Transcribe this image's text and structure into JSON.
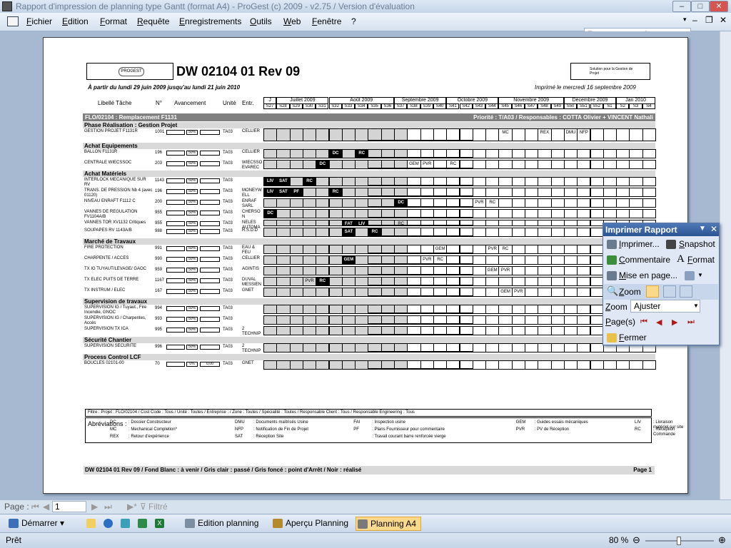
{
  "window": {
    "title": "Rapport d'impression de planning type Gantt (format A4) - ProGest (c) 2009 - v2.75 / Version d'évaluation"
  },
  "menu": {
    "items": [
      "Fichier",
      "Edition",
      "Format",
      "Requête",
      "Enregistrements",
      "Outils",
      "Web",
      "Fenêtre",
      "?"
    ],
    "ask_placeholder": "Tapez une question"
  },
  "report": {
    "title": "DW 02104 01 Rev 09",
    "period": "À partir du lundi 29 juin 2009 jusqu'au lundi 21 juin 2010",
    "printed": "Imprimé le mercredi 16 septembre 2009",
    "logo_left": "PROGEST",
    "logo_right": "Solution pour la Gestion de Projet",
    "columns": {
      "task": "Libellé Tâche",
      "num": "N°",
      "progress": "Avancement",
      "unit": "Unité",
      "entr": "Entr."
    },
    "months": [
      "J",
      "Juillet 2009",
      "Août 2009",
      "Septembre 2009",
      "Octobre 2009",
      "Novembre 2009",
      "Décembre 2009",
      "Jan 2010"
    ],
    "weeks": [
      "S27",
      "S28",
      "S29",
      "S30",
      "S31",
      "S32",
      "S33",
      "S34",
      "S35",
      "S36",
      "S37",
      "S38",
      "S39",
      "S40",
      "S41",
      "S42",
      "S43",
      "S44",
      "S45",
      "S46",
      "S47",
      "S48",
      "S49",
      "S50",
      "S51",
      "S52",
      "S1",
      "S2",
      "S3",
      "S4"
    ],
    "project_band": {
      "left": "FLO/02104 : Remplacement F1131",
      "right": "Priorité : T/A03 / Responsables : COTTA Olivier + VINCENT Nathali"
    },
    "phases": [
      {
        "name": "Phase Réalisation : Gestion Projet",
        "tasks": [
          {
            "label": "GESTION PROJET F1131R",
            "num": "1001",
            "pct": "50%",
            "unit": "TA03",
            "entr": "CELLIER",
            "marks": [
              "MC",
              "REX",
              "DMU",
              "NFP"
            ]
          }
        ]
      },
      {
        "name": "Achat Equipements",
        "tasks": [
          {
            "label": "BALLON F1131R",
            "num": "196",
            "pct": "50%",
            "unit": "TA03",
            "entr": "CELLIER",
            "marks": [
              "DC",
              "RC"
            ]
          },
          {
            "label": "CENTRALE WIECSSOC",
            "num": "203",
            "pct": "50%",
            "unit": "TA03",
            "entr": "WIECSSO EVAREC",
            "marks": [
              "DC",
              "GEM",
              "PVR",
              "RC"
            ]
          }
        ]
      },
      {
        "name": "Achat Matériels",
        "tasks": [
          {
            "label": "INTERLOCK MECANIQUE SUR RV",
            "num": "1143",
            "pct": "50%",
            "unit": "TA03",
            "entr": "",
            "marks": [
              "LIV",
              "SAT",
              "RC"
            ]
          },
          {
            "label": "TRANS. DE PRESSION Nb 4 (avec 01120)",
            "num": "196",
            "pct": "50%",
            "unit": "TA03",
            "entr": "MONEYW ELL",
            "marks": [
              "LIV",
              "SAT",
              "PF",
              "RC"
            ]
          },
          {
            "label": "NIVEAU ENRAFT F1112 C",
            "num": "200",
            "pct": "50%",
            "unit": "TA03",
            "entr": "ENRAF SARL",
            "marks": [
              "DC",
              "PVR",
              "RC"
            ]
          },
          {
            "label": "VANNES DE REGULATION FV1104A/B",
            "num": "955",
            "pct": "50%",
            "unit": "TA03",
            "entr": "CHERSO N",
            "marks": [
              "DC"
            ]
          },
          {
            "label": "VANNES TOR XV1132 Critiques",
            "num": "955",
            "pct": "50%",
            "unit": "TA03",
            "entr": "NELES AUTOMA",
            "marks": [
              "FAT",
              "LIV",
              "RC"
            ]
          },
          {
            "label": "SOUPAPES RV 1143A/B",
            "num": "988",
            "pct": "50%",
            "unit": "TA03",
            "entr": "R.S.D.D",
            "marks": [
              "SAT",
              "RC"
            ]
          }
        ]
      },
      {
        "name": "Marché de Travaux",
        "tasks": [
          {
            "label": "FIRE PROTECTION",
            "num": "991",
            "pct": "50%",
            "unit": "TA03",
            "entr": "EAU & FEU",
            "marks": [
              "GEM",
              "PVR",
              "RC"
            ]
          },
          {
            "label": "CHARPENTE / ACCES",
            "num": "990",
            "pct": "50%",
            "unit": "TA03",
            "entr": "CELLIER",
            "marks": [
              "GEM",
              "PVR",
              "RC"
            ]
          },
          {
            "label": "TX IG TUYAUT/LEVAGE/ GAOC",
            "num": "959",
            "pct": "50%",
            "unit": "TA03",
            "entr": "AGINTIS",
            "marks": [
              "GEM",
              "PVR"
            ]
          },
          {
            "label": "TX ELEC PUITS DE TERRE",
            "num": "1167",
            "pct": "50%",
            "unit": "TA03",
            "entr": "DUVAL MESSIEN",
            "marks": [
              "PVR",
              "RC"
            ]
          },
          {
            "label": "TX INSTRUM / ELEC",
            "num": "167",
            "pct": "50%",
            "unit": "TA03",
            "entr": "GNET",
            "marks": [
              "GEM",
              "PVR"
            ]
          }
        ]
      },
      {
        "name": "Supervision de travaux",
        "tasks": [
          {
            "label": "SUPERVISION IG / Tuyaut., Fire Incendie, GNOC",
            "num": "994",
            "pct": "50%",
            "unit": "TA03",
            "entr": "",
            "marks": []
          },
          {
            "label": "SUPERVISION IG / Charpentes, Accès",
            "num": "993",
            "pct": "50%",
            "unit": "TA03",
            "entr": "",
            "marks": []
          },
          {
            "label": "SUPERVISION TX ICA",
            "num": "995",
            "pct": "50%",
            "unit": "TA03",
            "entr": "2 TECHNIP",
            "marks": []
          }
        ]
      },
      {
        "name": "Sécurité Chantier",
        "tasks": [
          {
            "label": "SUPERVISION SECURITE",
            "num": "996",
            "pct": "50%",
            "unit": "TA03",
            "entr": "2 TECHNIP",
            "marks": []
          }
        ]
      },
      {
        "name": "Process Control LCF",
        "tasks": [
          {
            "label": "BOUCLES 02101-00",
            "num": "70",
            "pct": "20",
            "unit": "TA03",
            "entr": "GNET",
            "marks": [],
            "extra": [
              "0%",
              "0,00"
            ]
          }
        ]
      }
    ],
    "filter": "Filtre : Projet : FLO/02104 / Cost Code : Tous / Unité : Toutes / Entreprise : / Zone : Toutes / Spécialité : Toutes / Responsable Client : Tous / Responsable Engineering : Tous",
    "abbrev_title": "Abréviations :",
    "abbrev": [
      [
        "DC",
        ": Dossier Constructeur",
        "DMU",
        ": Documents maîtrisés Usine",
        "FAI",
        ": Inspection usine",
        "GEM",
        ": Guides essais mécaniques",
        "LIV",
        ": Livraison matériel sur site"
      ],
      [
        "MC",
        ": Mechanical Completion*",
        "NFP",
        ": Notification de Fin de Projet",
        "PF",
        ": Plans Fournisseur pour commentaire",
        "PVR",
        ": PV de Réception",
        "RC",
        ": Réception Commande"
      ],
      [
        "REX",
        ": Retour d'expérience",
        "SAT",
        ": Réception Site",
        "",
        ": Travail courant barre renforcée vierge",
        "",
        ""
      ]
    ],
    "footer_left": "DW 02104 01 Rev 09 / Fond Blanc : à venir / Gris clair : passé / Gris foncé : point d'Arrêt / Noir : réalisé",
    "footer_right": "Page 1"
  },
  "print_panel": {
    "title": "Imprimer Rapport",
    "print": "Imprimer...",
    "snapshot": "Snapshot",
    "comment": "Commentaire",
    "format": "Format",
    "pagesetup": "Mise en page...",
    "zoom_btn": "Zoom",
    "zoom_label": "Zoom :",
    "zoom_value": "Ajuster",
    "pages_label": "Page(s)",
    "close": "Fermer"
  },
  "pager": {
    "label": "Page :",
    "value": "1",
    "filter": "Filtré"
  },
  "taskbar": {
    "start": "Démarrer",
    "items": [
      "Edition planning",
      "Aperçu Planning",
      "Planning A4"
    ]
  },
  "status": {
    "text": "Prêt",
    "zoom": "80 %"
  }
}
